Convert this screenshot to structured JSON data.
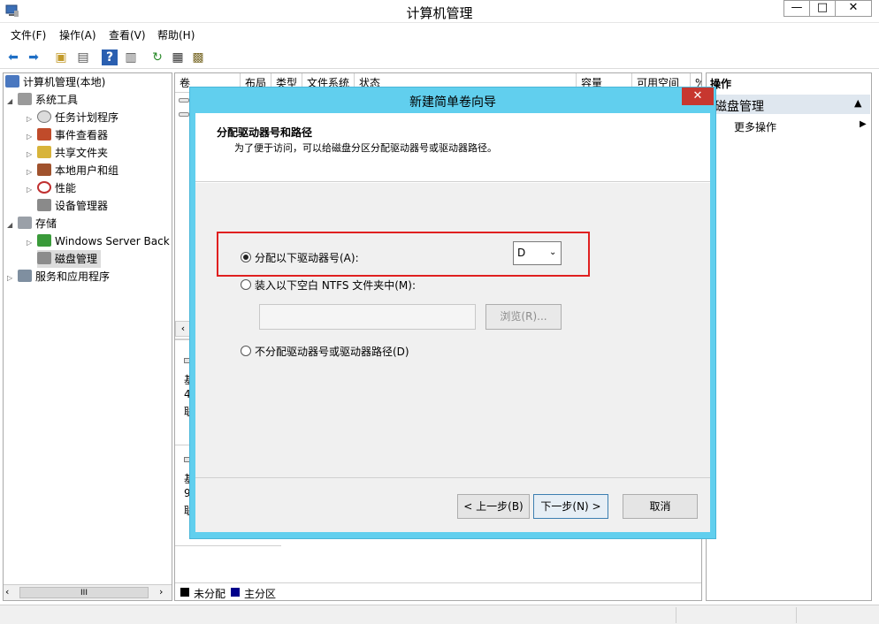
{
  "window": {
    "title": "计算机管理",
    "minimize": "—",
    "maximize": "□",
    "close": "✕"
  },
  "menu": [
    "文件(F)",
    "操作(A)",
    "查看(V)",
    "帮助(H)"
  ],
  "tree": {
    "root": "计算机管理(本地)",
    "system_tools": "系统工具",
    "task_scheduler": "任务计划程序",
    "event_viewer": "事件查看器",
    "shared_folders": "共享文件夹",
    "local_users": "本地用户和组",
    "performance": "性能",
    "device_manager": "设备管理器",
    "storage": "存储",
    "windows_backup": "Windows Server Back",
    "disk_management": "磁盘管理",
    "services_apps": "服务和应用程序",
    "hscroll_grip": "III"
  },
  "table_columns": [
    "卷",
    "布局",
    "类型",
    "文件系统",
    "状态",
    "容量",
    "可用空间",
    "%"
  ],
  "disk_fragments": {
    "d1a": "基",
    "d1b": "4",
    "d1c": "联",
    "d2a": "基",
    "d2b": "9",
    "d2c": "联"
  },
  "legend": {
    "unallocated": "未分配",
    "primary": "主分区",
    "unallocated_color": "#000000",
    "primary_color": "#00008b"
  },
  "actions": {
    "header": "操作",
    "section": "磁盘管理",
    "more": "更多操作"
  },
  "dialog": {
    "title": "新建简单卷向导",
    "close": "✕",
    "heading": "分配驱动器号和路径",
    "subheading": "为了便于访问，可以给磁盘分区分配驱动器号或驱动器路径。",
    "option_assign": "分配以下驱动器号(A):",
    "drive_letter": "D",
    "option_mount": "装入以下空白 NTFS 文件夹中(M):",
    "mount_path": "",
    "browse": "浏览(R)...",
    "option_none": "不分配驱动器号或驱动器路径(D)",
    "back": "< 上一步(B)",
    "next": "下一步(N) >",
    "cancel": "取消",
    "highlight_color": "#e02020",
    "accent_color": "#61cfee"
  }
}
